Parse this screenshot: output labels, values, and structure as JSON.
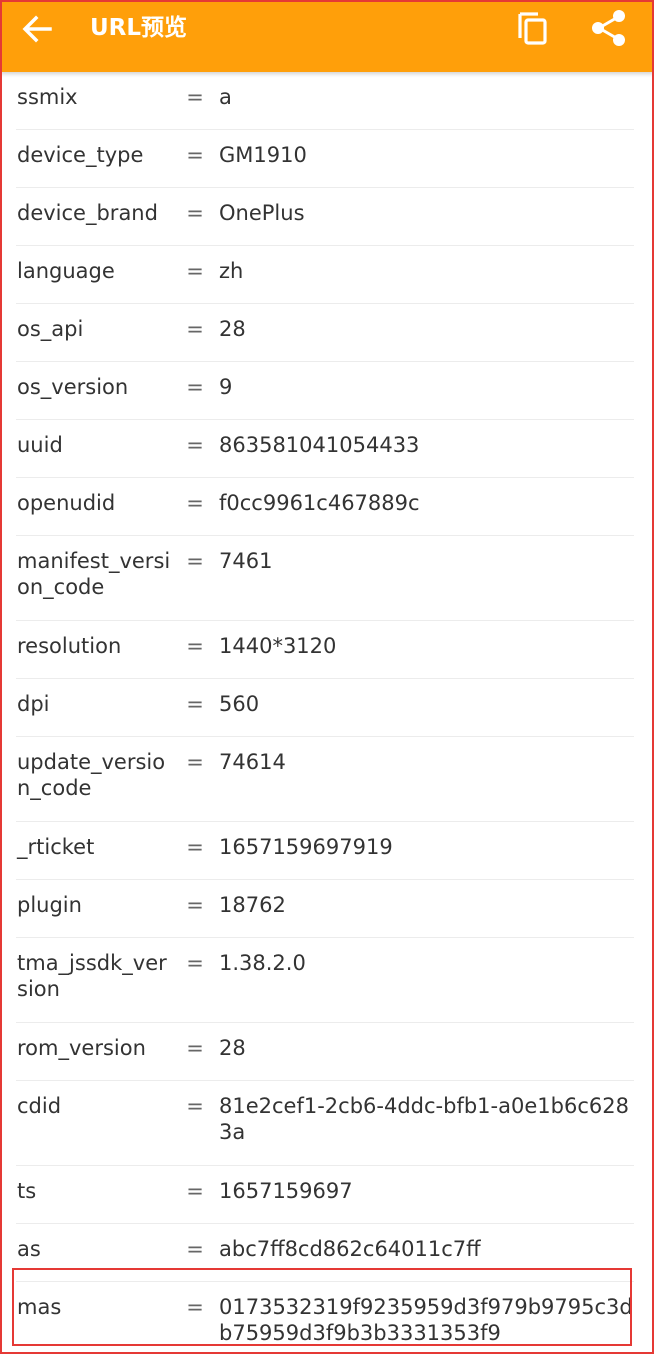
{
  "app_bar": {
    "title": "URL预览",
    "background": "#ff9f0a",
    "icons": [
      "back-arrow-icon",
      "copy-icon",
      "share-icon"
    ]
  },
  "params": [
    {
      "key": "ssmix",
      "value": "a"
    },
    {
      "key": "device_type",
      "value": "GM1910"
    },
    {
      "key": "device_brand",
      "value": "OnePlus"
    },
    {
      "key": "language",
      "value": "zh"
    },
    {
      "key": "os_api",
      "value": "28"
    },
    {
      "key": "os_version",
      "value": "9"
    },
    {
      "key": "uuid",
      "value": "863581041054433"
    },
    {
      "key": "openudid",
      "value": "f0cc9961c467889c"
    },
    {
      "key": "manifest_version_code",
      "value": "7461"
    },
    {
      "key": "resolution",
      "value": "1440*3120"
    },
    {
      "key": "dpi",
      "value": "560"
    },
    {
      "key": "update_version_code",
      "value": "74614"
    },
    {
      "key": "_rticket",
      "value": "1657159697919"
    },
    {
      "key": "plugin",
      "value": "18762"
    },
    {
      "key": "tma_jssdk_version",
      "value": "1.38.2.0"
    },
    {
      "key": "rom_version",
      "value": "28"
    },
    {
      "key": "cdid",
      "value": "81e2cef1-2cb6-4ddc-bfb1-a0e1b6c6283a"
    },
    {
      "key": "ts",
      "value": "1657159697"
    },
    {
      "key": "as",
      "value": "abc7ff8cd862c64011c7ff"
    },
    {
      "key": "mas",
      "value": "0173532319f9235959d3f979b9795c3db75959d3f9b3b3331353f9"
    }
  ],
  "separator": "=",
  "highlight_color": "#e53935"
}
